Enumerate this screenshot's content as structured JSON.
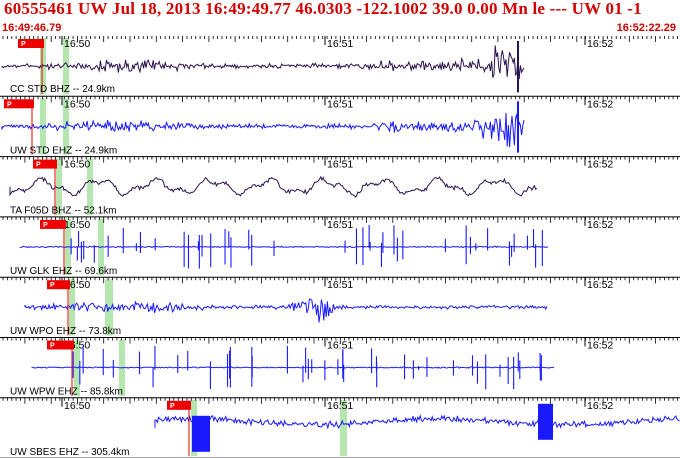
{
  "header": {
    "title": "60555461 UW Jul 18, 2013 16:49:49.77   46.0303 -122.1002 39.0 0.00 Mn le --- UW 01  -1",
    "start_time": "16:49:46.79",
    "end_time": "16:52:22.29"
  },
  "time_ticks": [
    "16:50",
    "16:51",
    "16:52"
  ],
  "pick_label": "P",
  "colors": {
    "title": "#d40000",
    "pick": "#ee0000",
    "blue_trace": "#1a1aff",
    "dark_trace": "#2a1450",
    "window_shade": "#b6e6b0"
  },
  "traces": [
    {
      "label": "CC STD BHZ -- 24.9km",
      "color": "dark",
      "kind": "quake"
    },
    {
      "label": "UW STD EHZ -- 24.9km",
      "color": "blue",
      "kind": "quake"
    },
    {
      "label": "TA F05D BHZ -- 52.1km",
      "color": "dark",
      "kind": "wavy"
    },
    {
      "label": "UW GLK EHZ -- 69.6km",
      "color": "blue",
      "kind": "spiky"
    },
    {
      "label": "UW WPO EHZ -- 73.8km",
      "color": "blue",
      "kind": "burst"
    },
    {
      "label": "UW WPW EHZ -- 85.8km",
      "color": "blue",
      "kind": "spiky"
    },
    {
      "label": "UW SBES EHZ -- 305.4km",
      "color": "blue",
      "kind": "tele"
    }
  ]
}
